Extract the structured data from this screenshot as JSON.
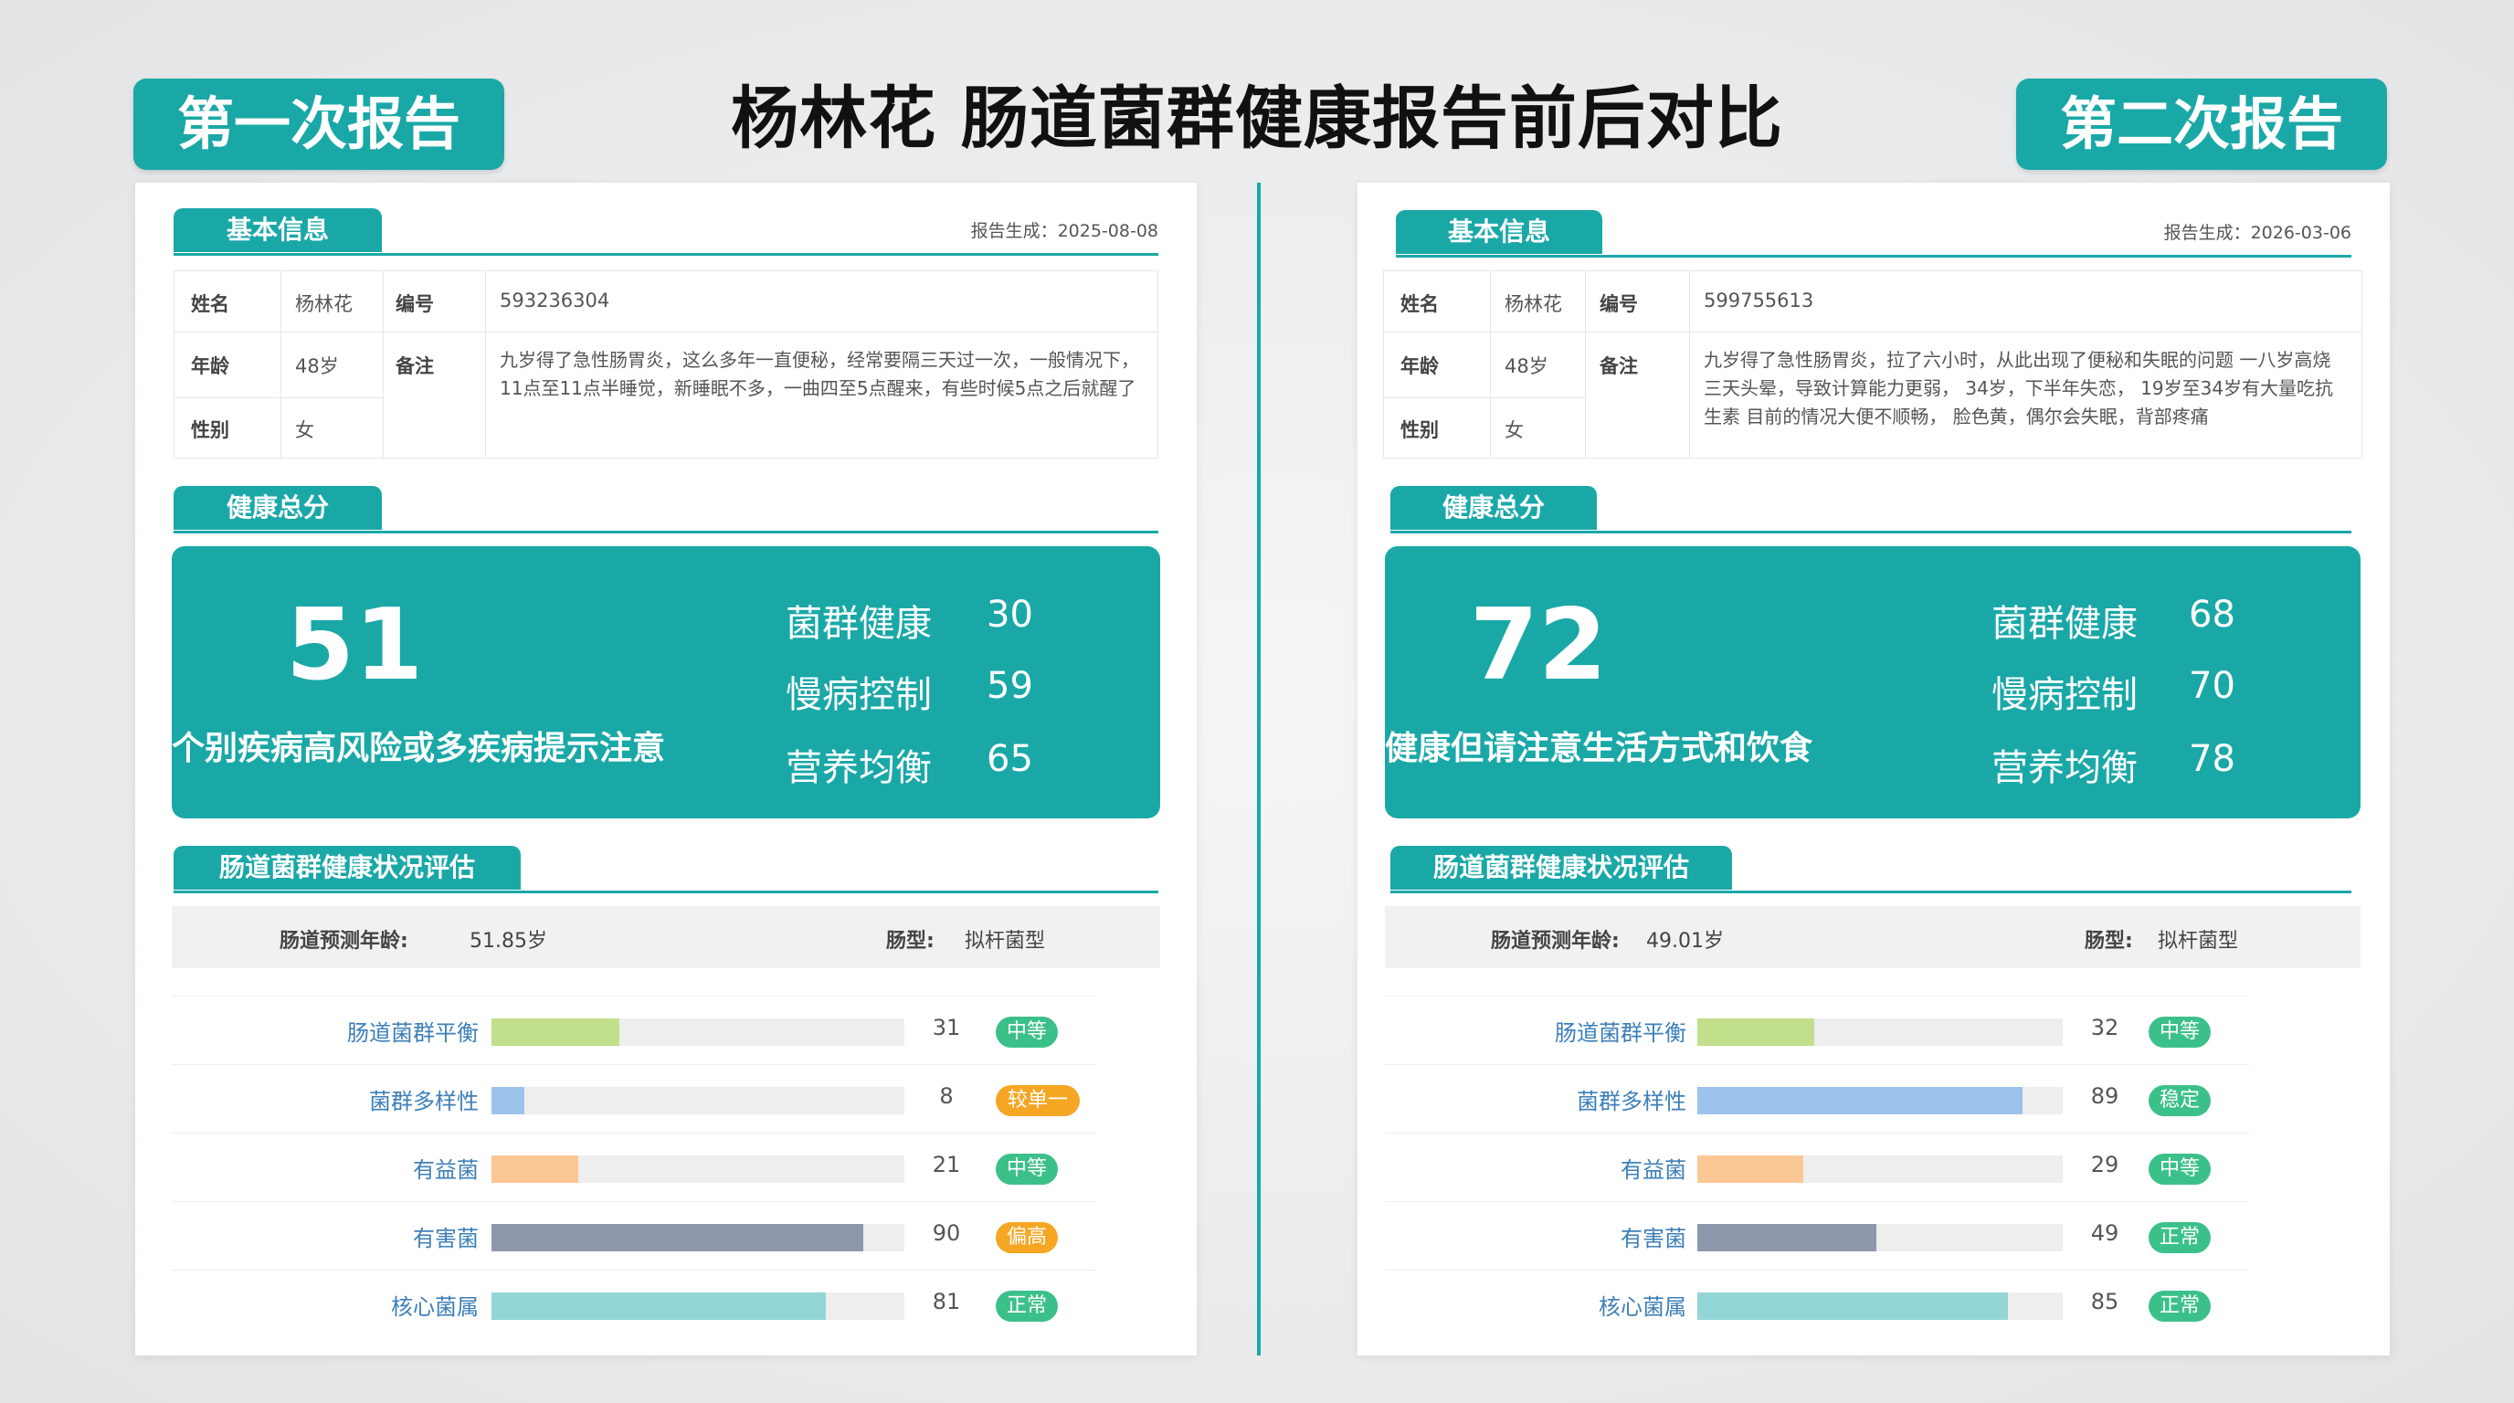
{
  "title": "杨林花 肠道菌群健康报告前后对比",
  "labels": {
    "first": "第一次报告",
    "second": "第二次报告"
  },
  "first": {
    "basic_title": "基本信息",
    "gen_date": "报告生成：2025-08-08",
    "info": {
      "name_key": "姓名",
      "name": "杨林花",
      "id_key": "编号",
      "id": "593236304",
      "age_key": "年龄",
      "age": "48岁",
      "note_key": "备注",
      "note": "九岁得了急性肠胃炎，这么多年一直便秘，经常要隔三天过一次，一般情况下，11点至11点半睡觉，新睡眠不多，一曲四至5点醒来，有些时候5点之后就醒了",
      "sex_key": "性别",
      "sex": "女"
    },
    "score_title": "健康总分",
    "score": "51",
    "score_desc": "个别疾病高风险或多疾病提示注意",
    "subs": [
      {
        "label": "菌群健康",
        "value": "30"
      },
      {
        "label": "慢病控制",
        "value": "59"
      },
      {
        "label": "营养均衡",
        "value": "65"
      }
    ],
    "eval_title": "肠道菌群健康状况评估",
    "pred_age_key": "肠道预测年龄:",
    "pred_age": "51.85岁",
    "type_key": "肠型:",
    "type": "拟杆菌型",
    "metrics": [
      {
        "name": "肠道菌群平衡",
        "value": 31,
        "value_text": "31",
        "badge": "中等",
        "bar_color": "#c2df8c",
        "badge_color": "#3cc08a"
      },
      {
        "name": "菌群多样性",
        "value": 8,
        "value_text": "8",
        "badge": "较单一",
        "bar_color": "#9cc3ec",
        "badge_color": "#f5a623"
      },
      {
        "name": "有益菌",
        "value": 21,
        "value_text": "21",
        "badge": "中等",
        "bar_color": "#fbc795",
        "badge_color": "#3cc08a"
      },
      {
        "name": "有害菌",
        "value": 90,
        "value_text": "90",
        "badge": "偏高",
        "bar_color": "#8e97ab",
        "badge_color": "#f5a623"
      },
      {
        "name": "核心菌属",
        "value": 81,
        "value_text": "81",
        "badge": "正常",
        "bar_color": "#93d6d6",
        "badge_color": "#3cc08a"
      }
    ]
  },
  "second": {
    "basic_title": "基本信息",
    "gen_date": "报告生成：2026-03-06",
    "info": {
      "name_key": "姓名",
      "name": "杨林花",
      "id_key": "编号",
      "id": "599755613",
      "age_key": "年龄",
      "age": "48岁",
      "note_key": "备注",
      "note": "九岁得了急性肠胃炎，拉了六小时，从此出现了便秘和失眠的问题 一八岁高烧三天头晕，导致计算能力更弱， 34岁，下半年失恋， 19岁至34岁有大量吃抗生素 目前的情况大便不顺畅， 脸色黄，偶尔会失眠，背部疼痛",
      "sex_key": "性别",
      "sex": "女"
    },
    "score_title": "健康总分",
    "score": "72",
    "score_desc": "健康但请注意生活方式和饮食",
    "subs": [
      {
        "label": "菌群健康",
        "value": "68"
      },
      {
        "label": "慢病控制",
        "value": "70"
      },
      {
        "label": "营养均衡",
        "value": "78"
      }
    ],
    "eval_title": "肠道菌群健康状况评估",
    "pred_age_key": "肠道预测年龄:",
    "pred_age": "49.01岁",
    "type_key": "肠型:",
    "type": "拟杆菌型",
    "metrics": [
      {
        "name": "肠道菌群平衡",
        "value": 32,
        "value_text": "32",
        "badge": "中等",
        "bar_color": "#c2df8c",
        "badge_color": "#3cc08a"
      },
      {
        "name": "菌群多样性",
        "value": 89,
        "value_text": "89",
        "badge": "稳定",
        "bar_color": "#9cc3ec",
        "badge_color": "#3cc08a"
      },
      {
        "name": "有益菌",
        "value": 29,
        "value_text": "29",
        "badge": "中等",
        "bar_color": "#fbc795",
        "badge_color": "#3cc08a"
      },
      {
        "name": "有害菌",
        "value": 49,
        "value_text": "49",
        "badge": "正常",
        "bar_color": "#8e97ab",
        "badge_color": "#3cc08a"
      },
      {
        "name": "核心菌属",
        "value": 85,
        "value_text": "85",
        "badge": "正常",
        "bar_color": "#93d6d6",
        "badge_color": "#3cc08a"
      }
    ]
  }
}
